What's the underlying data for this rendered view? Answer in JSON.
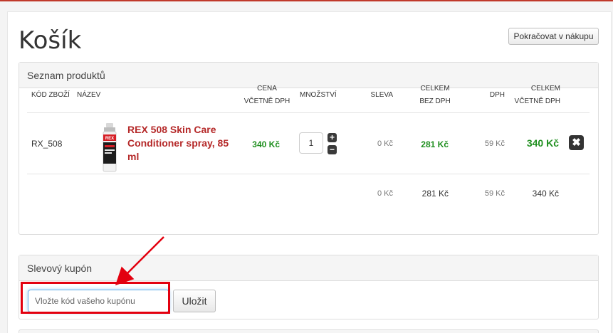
{
  "page": {
    "title": "Košík",
    "continue_label": "Pokračovat v nákupu"
  },
  "products_panel": {
    "heading": "Seznam produktů",
    "columns": {
      "code": "KÓD ZBOŽÍ",
      "name": "NÁZEV",
      "price_line1": "CENA",
      "price_line2": "VČETNĚ DPH",
      "quantity": "MNOŽSTVÍ",
      "discount": "SLEVA",
      "total_excl_line1": "CELKEM",
      "total_excl_line2": "BEZ DPH",
      "vat": "DPH",
      "total_incl_line1": "CELKEM",
      "total_incl_line2": "VČETNĚ DPH"
    },
    "items": [
      {
        "code": "RX_508",
        "name": "REX 508 Skin Care Conditioner spray, 85 ml",
        "price_incl_vat": "340 Kč",
        "quantity": "1",
        "discount": "0 Kč",
        "total_excl_vat": "281 Kč",
        "vat": "59 Kč",
        "total_incl_vat": "340 Kč",
        "image_label": "REX"
      }
    ],
    "summary": {
      "discount": "0 Kč",
      "total_excl_vat": "281 Kč",
      "vat": "59 Kč",
      "total_incl_vat": "340 Kč"
    },
    "icons": {
      "increase": "plus-icon",
      "decrease": "minus-icon",
      "remove": "close-icon"
    }
  },
  "coupon_panel": {
    "heading": "Slevový kupón",
    "placeholder": "Vložte kód vašeho kupónu",
    "value": "",
    "save_label": "Uložit"
  },
  "colors": {
    "accent_red": "#b52929",
    "price_green": "#1f8f1f",
    "annotation_red": "#e3000f",
    "input_focus": "#66afe9"
  }
}
